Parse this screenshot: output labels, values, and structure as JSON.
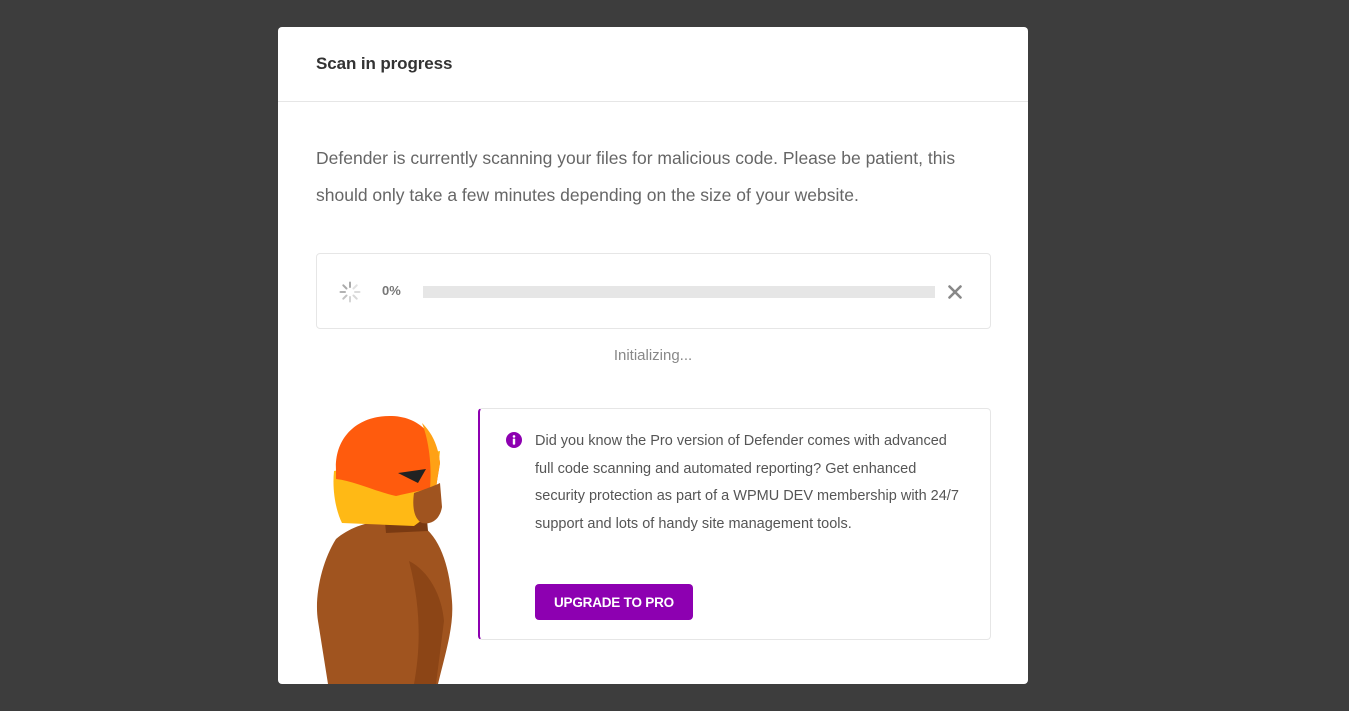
{
  "modal": {
    "title": "Scan in progress",
    "description": "Defender is currently scanning your files for malicious code. Please be patient, this should only take a few minutes depending on the size of your website."
  },
  "progress": {
    "percent_label": "0%",
    "value": 0,
    "spinner_icon": "loader-icon",
    "cancel_icon": "close-icon",
    "status": "Initializing..."
  },
  "notice": {
    "icon": "info-icon",
    "text": "Did you know the Pro version of Defender comes with advanced full code scanning and automated reporting? Get enhanced security protection as part of a WPMU DEV membership with 24/7 support and lots of handy site management tools.",
    "button_label": "UPGRADE TO PRO"
  },
  "colors": {
    "overlay": "#3d3d3d",
    "accent_purple": "#8d00b1",
    "track": "#e6e6e6"
  }
}
